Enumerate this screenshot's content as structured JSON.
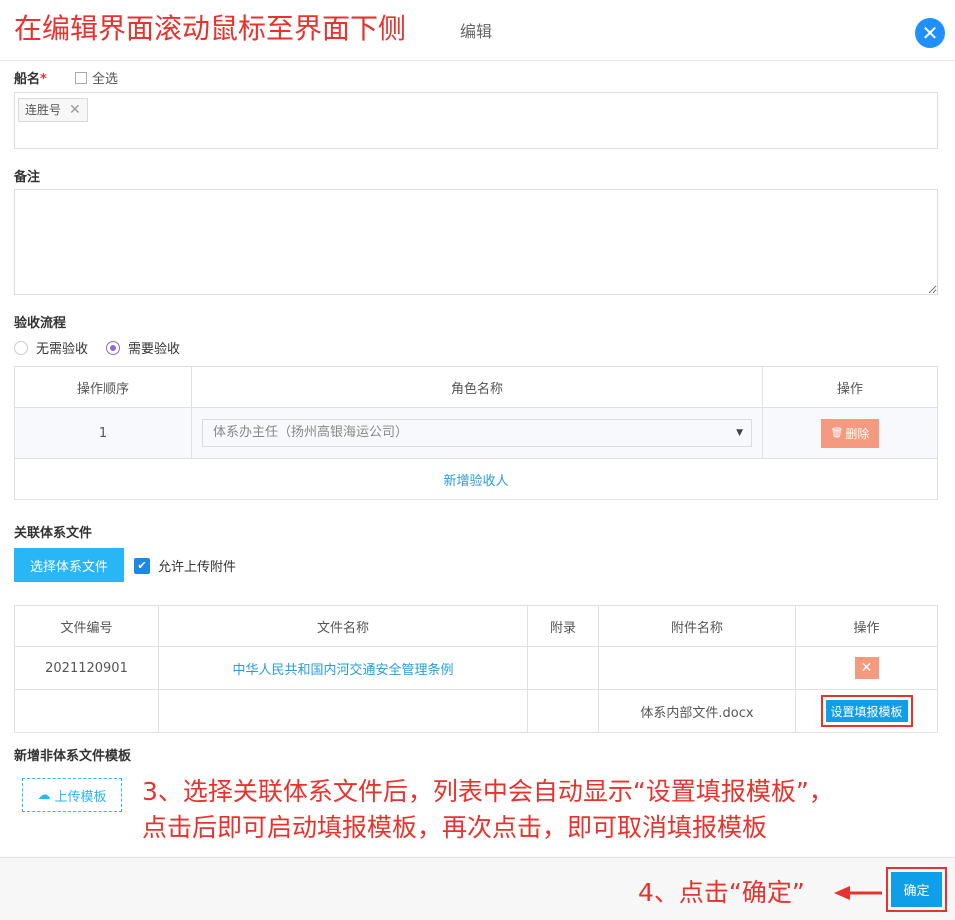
{
  "header": {
    "annotation": "在编辑界面滚动鼠标至界面下侧",
    "title": "编辑",
    "close_icon": "close-icon"
  },
  "ship": {
    "label": "船名",
    "required_mark": "*",
    "select_all": "全选",
    "tags": [
      "连胜号"
    ]
  },
  "remark": {
    "label": "备注"
  },
  "acceptance": {
    "label": "验收流程",
    "options": [
      "无需验收",
      "需要验收"
    ],
    "selected": "需要验收",
    "columns": [
      "操作顺序",
      "角色名称",
      "操作"
    ],
    "rows": [
      {
        "order": "1",
        "role": "体系办主任（扬州高银海运公司）",
        "action": "删除"
      }
    ],
    "add_label": "新增验收人"
  },
  "related_files": {
    "label": "关联体系文件",
    "select_button": "选择体系文件",
    "allow_upload": "允许上传附件",
    "columns": [
      "文件编号",
      "文件名称",
      "附录",
      "附件名称",
      "操作"
    ],
    "rows": [
      {
        "code": "2021120901",
        "name": "中华人民共和国内河交通安全管理条例",
        "appendix": "",
        "attachment": ""
      },
      {
        "code": "",
        "name": "",
        "appendix": "",
        "attachment": "体系内部文件.docx",
        "action": "设置填报模板"
      }
    ]
  },
  "non_system": {
    "label": "新增非体系文件模板",
    "upload_button": "上传模板"
  },
  "annotations": {
    "step3_line1": "3、选择关联体系文件后，列表中会自动显示“设置填报模板”，",
    "step3_line2": "点击后即可启动填报模板，再次点击，即可取消填报模板",
    "step4": "4、点击“确定”"
  },
  "footer": {
    "confirm": "确定"
  },
  "colors": {
    "accent": "#29b6f6",
    "annotation": "#e8322d",
    "danger": "#f59a7e"
  }
}
